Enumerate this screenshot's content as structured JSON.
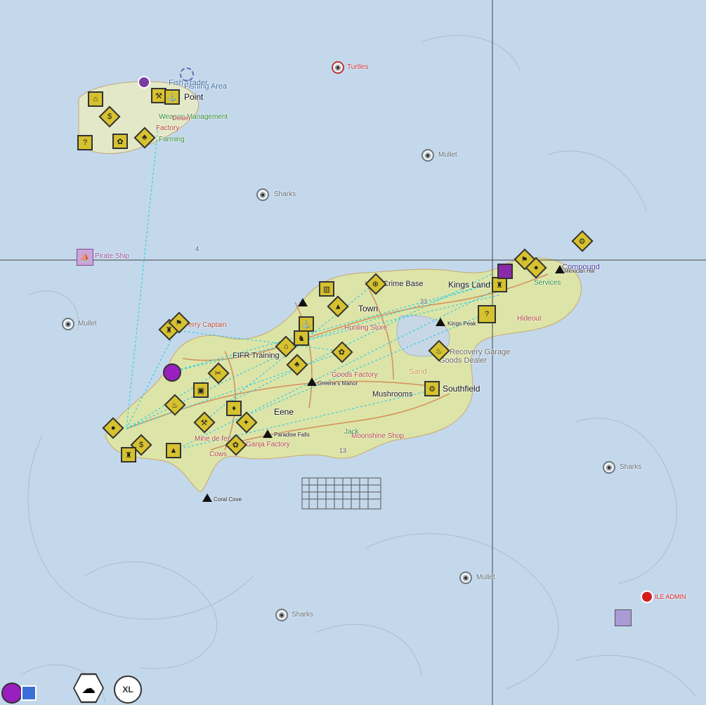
{
  "map": {
    "fish_spots": [
      {
        "label": "Turtles"
      },
      {
        "label": "Mullet"
      },
      {
        "label": "Sharks"
      },
      {
        "label": "Mullet"
      },
      {
        "label": "Sharks"
      },
      {
        "label": "Mullet"
      },
      {
        "label": "Sharks"
      }
    ],
    "pirate_ship": {
      "label": "Pirate Ship"
    },
    "admin_marker": {
      "label": "ILE ADMIN"
    },
    "towns": {
      "kings_land": "Kings Land",
      "eene": "Eene",
      "north_point": "Point",
      "east_town": "Town",
      "southfield": "Southfield",
      "coral_cove": "Coral Cove"
    },
    "places": [
      {
        "label": "Crime Base"
      },
      {
        "label": "FIFR Training"
      },
      {
        "label": "Recovery Garage"
      },
      {
        "label": "Goods Factory"
      },
      {
        "label": "Goods Dealer"
      },
      {
        "label": "Mushrooms"
      },
      {
        "label": "Moonshine Shop"
      },
      {
        "label": "Hunting Store"
      },
      {
        "label": "Mine de fer"
      },
      {
        "label": "Cows"
      },
      {
        "label": "Paradise Falls"
      },
      {
        "label": "Greene's Manor"
      },
      {
        "label": "Kings Peak"
      },
      {
        "label": "Mexican Hill"
      },
      {
        "label": "Hideout"
      },
      {
        "label": "Services"
      },
      {
        "label": "Sand"
      },
      {
        "label": "Ferry Captain"
      },
      {
        "label": "Fishing Area"
      },
      {
        "label": "Fish Trader"
      },
      {
        "label": "Weapon Management"
      },
      {
        "label": "Factory"
      },
      {
        "label": "Dealer"
      },
      {
        "label": "Farming"
      },
      {
        "label": "Jack"
      },
      {
        "label": "Ganja Factory"
      },
      {
        "label": "Compound"
      }
    ],
    "grid_ids": [
      "4",
      "33",
      "13"
    ]
  },
  "hud": {
    "weather_icon": "cloud-lightning-icon",
    "xl_label": "XL",
    "profile_icon": "avatar"
  },
  "colors": {
    "sea": "#c4d8ec",
    "land": "#dde4a8",
    "shop_marker": "#d6c12f",
    "route_line": "#2fd0e0",
    "grid_line": "#444444"
  }
}
